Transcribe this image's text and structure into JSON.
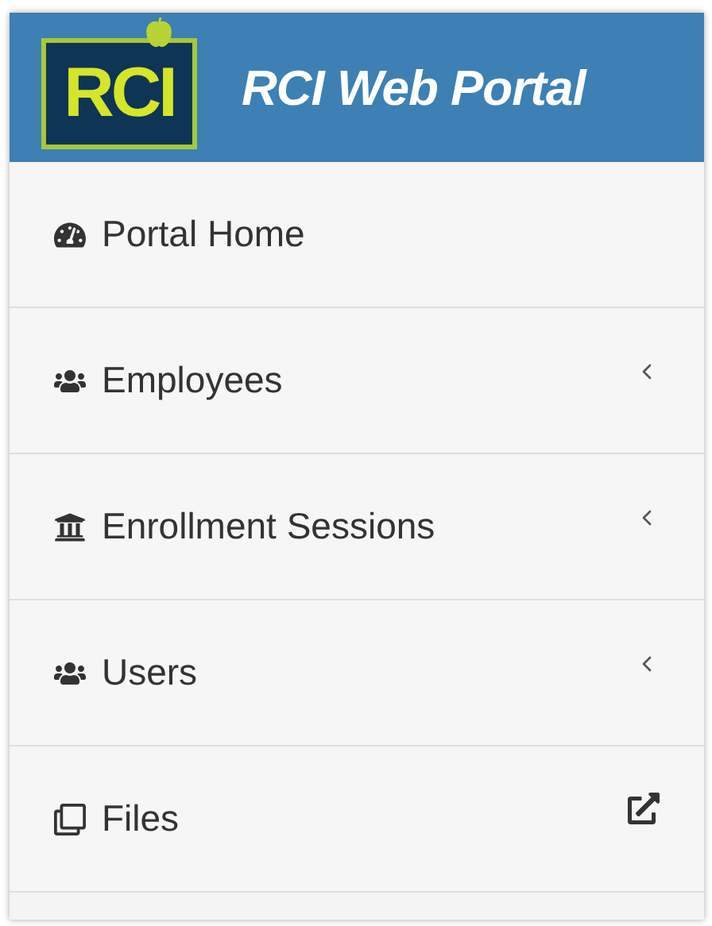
{
  "header": {
    "logo_text": "RCI",
    "title": "RCI Web Portal"
  },
  "menu": [
    {
      "label": "Portal Home",
      "kind": "page"
    },
    {
      "label": "Employees",
      "kind": "submenu"
    },
    {
      "label": "Enrollment Sessions",
      "kind": "submenu"
    },
    {
      "label": "Users",
      "kind": "submenu"
    },
    {
      "label": "Files",
      "kind": "external"
    }
  ]
}
